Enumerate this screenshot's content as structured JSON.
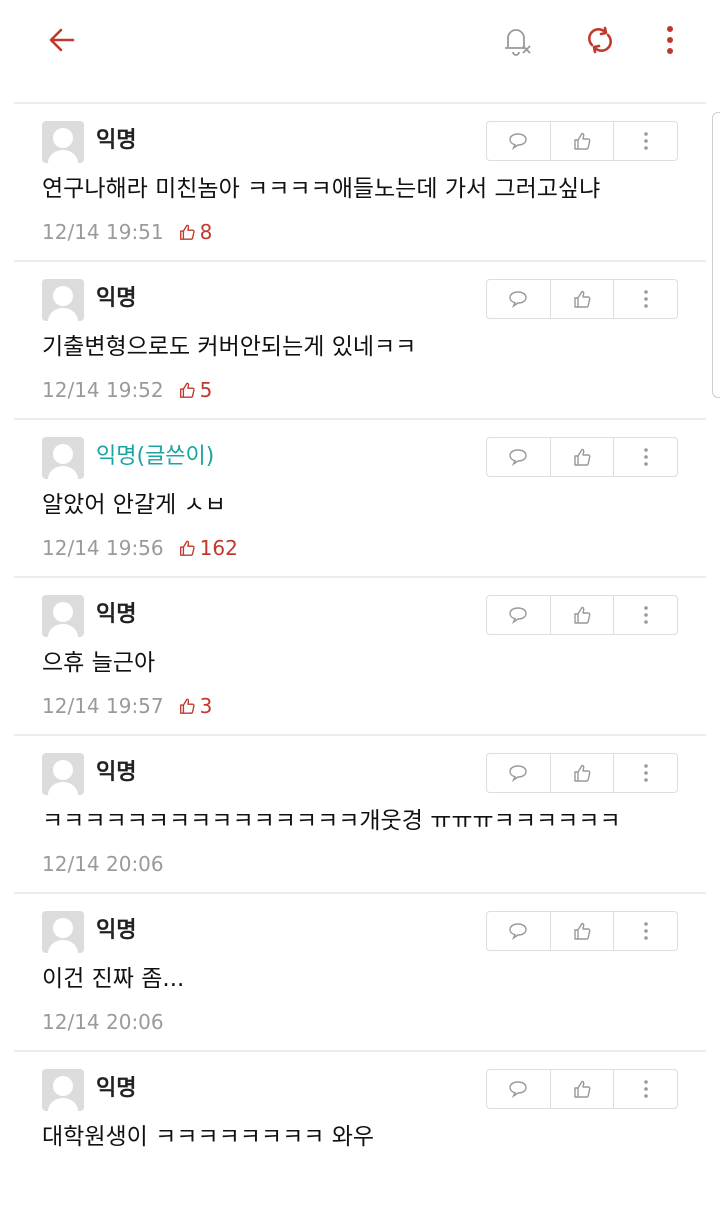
{
  "topbar": {
    "back_icon": "arrow-left-icon",
    "bell_icon": "notification-off-icon",
    "refresh_icon": "refresh-icon",
    "more_icon": "more-vertical-icon"
  },
  "colors": {
    "accent": "#c0392b",
    "op_name": "#1ba3a0",
    "meta": "#9a9a9a"
  },
  "comments": [
    {
      "author": "익명",
      "is_op": false,
      "text": "연구나해라 미친놈아 ㅋㅋㅋㅋ애들노는데 가서 그러고싶냐",
      "time": "12/14 19:51",
      "likes": "8"
    },
    {
      "author": "익명",
      "is_op": false,
      "text": "기출변형으로도 커버안되는게 있네ㅋㅋ",
      "time": "12/14 19:52",
      "likes": "5"
    },
    {
      "author": "익명(글쓴이)",
      "is_op": true,
      "text": "알았어 안갈게 ㅅㅂ",
      "time": "12/14 19:56",
      "likes": "162"
    },
    {
      "author": "익명",
      "is_op": false,
      "text": "으휴 늘근아",
      "time": "12/14 19:57",
      "likes": "3"
    },
    {
      "author": "익명",
      "is_op": false,
      "text": "ㅋㅋㅋㅋㅋㅋㅋㅋㅋㅋㅋㅋㅋㅋㅋ개웃경 ㅠㅠㅠㅋㅋㅋㅋㅋㅋ",
      "time": "12/14 20:06",
      "likes": ""
    },
    {
      "author": "익명",
      "is_op": false,
      "text": "이건 진짜 좀...",
      "time": "12/14 20:06",
      "likes": ""
    },
    {
      "author": "익명",
      "is_op": false,
      "text": "대학원생이 ㅋㅋㅋㅋㅋㅋㅋㅋ 와우",
      "time": "",
      "likes": ""
    }
  ]
}
